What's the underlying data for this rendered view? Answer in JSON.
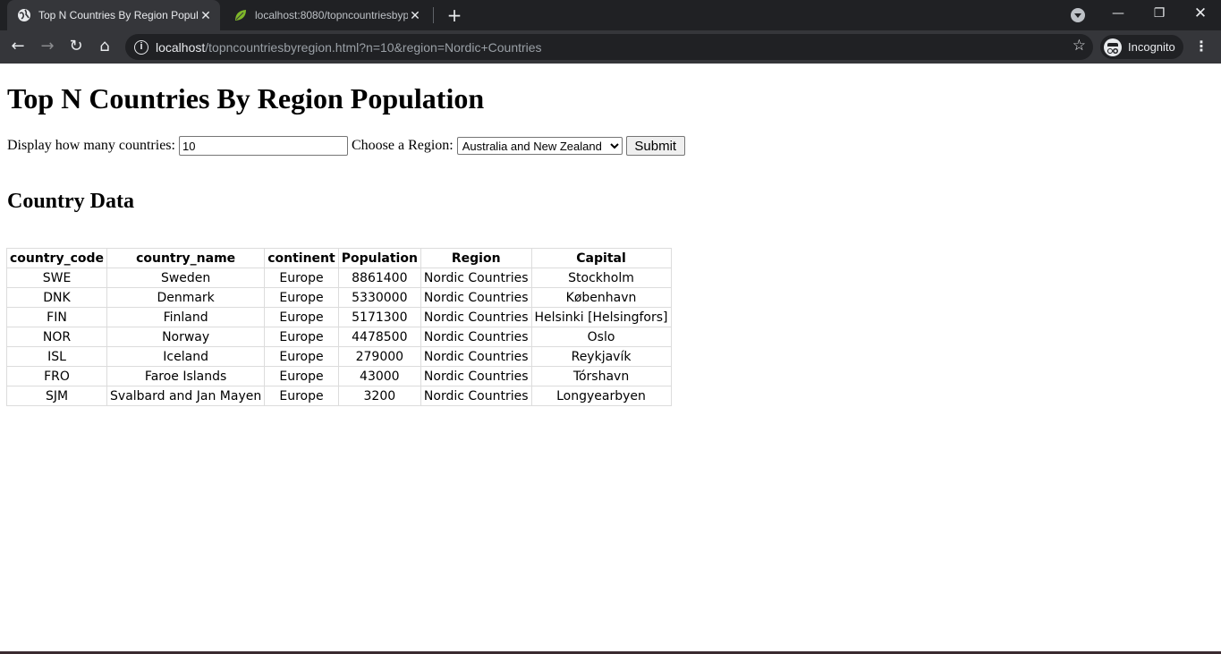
{
  "browser": {
    "tabs": [
      {
        "title": "Top N Countries By Region Popul",
        "active": true,
        "favicon": "globe-icon"
      },
      {
        "title": "localhost:8080/topncountriesbyp",
        "active": false,
        "favicon": "spring-leaf-icon"
      }
    ],
    "url_host": "localhost",
    "url_rest": "/topncountriesbyregion.html?n=10&region=Nordic+Countries",
    "profile_label": "Incognito",
    "colors": {
      "frame": "#202124",
      "toolbar": "#35363a",
      "text": "#e8eaed"
    }
  },
  "page": {
    "title": "Top N Countries By Region Population",
    "form": {
      "count_label": "Display how many countries:",
      "count_value": "10",
      "region_label": "Choose a Region:",
      "region_selected": "Australia and New Zealand",
      "submit_label": "Submit"
    },
    "section_title": "Country Data",
    "table": {
      "headers": [
        "country_code",
        "country_name",
        "continent",
        "Population",
        "Region",
        "Capital"
      ],
      "rows": [
        [
          "SWE",
          "Sweden",
          "Europe",
          "8861400",
          "Nordic Countries",
          "Stockholm"
        ],
        [
          "DNK",
          "Denmark",
          "Europe",
          "5330000",
          "Nordic Countries",
          "København"
        ],
        [
          "FIN",
          "Finland",
          "Europe",
          "5171300",
          "Nordic Countries",
          "Helsinki [Helsingfors]"
        ],
        [
          "NOR",
          "Norway",
          "Europe",
          "4478500",
          "Nordic Countries",
          "Oslo"
        ],
        [
          "ISL",
          "Iceland",
          "Europe",
          "279000",
          "Nordic Countries",
          "Reykjavík"
        ],
        [
          "FRO",
          "Faroe Islands",
          "Europe",
          "43000",
          "Nordic Countries",
          "Tórshavn"
        ],
        [
          "SJM",
          "Svalbard and Jan Mayen",
          "Europe",
          "3200",
          "Nordic Countries",
          "Longyearbyen"
        ]
      ]
    }
  }
}
